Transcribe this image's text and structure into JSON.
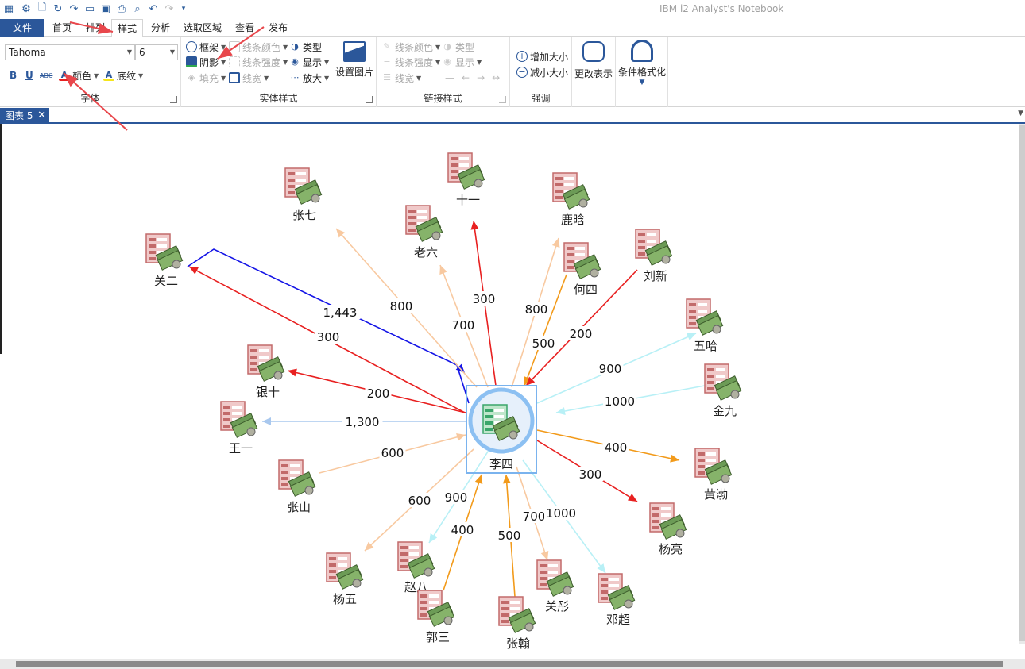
{
  "app_title": "IBM i2 Analyst's Notebook",
  "tabs": [
    "文件",
    "首页",
    "排列",
    "样式",
    "分析",
    "选取区域",
    "查看",
    "发布"
  ],
  "ribbon": {
    "font_group": {
      "label": "字体",
      "font_name": "Tahoma",
      "font_size": "6",
      "bold": "B",
      "underline": "U",
      "strike": "ABC",
      "color": "颜色",
      "shading": "底纹"
    },
    "entity_style": {
      "label": "实体样式",
      "frame": "框架",
      "shadow": "阴影",
      "fill": "填充",
      "line_color": "线条颜色",
      "line_strength": "线条强度",
      "line_width": "线宽",
      "type": "类型",
      "show": "显示",
      "enlarge": "放大",
      "set_picture": "设置图片"
    },
    "link_style": {
      "label": "链接样式",
      "line_color": "线条颜色",
      "line_strength": "线条强度",
      "line_width": "线宽",
      "type": "类型",
      "show": "显示"
    },
    "emphasis": {
      "label": "强调",
      "increase": "增加大小",
      "decrease": "减小大小"
    },
    "change_repr": "更改表示",
    "conditional_format": "条件格式化"
  },
  "document_tab": "图表 5",
  "colors": {
    "file_tab": "#2b579a",
    "link_red": "#e82020",
    "link_orange": "#f29a1a",
    "link_peach": "#f8c9a0",
    "link_cyan": "#b8f0f6",
    "link_lightblue": "#a9c8ee",
    "link_blue": "#1414e6",
    "annotation_arrow": "#e8474c"
  },
  "graph": {
    "center": "李四",
    "nodes": [
      {
        "id": "zhangqi",
        "label": "张七"
      },
      {
        "id": "shiyi",
        "label": "十一"
      },
      {
        "id": "luhan",
        "label": "鹿晗"
      },
      {
        "id": "laoliu",
        "label": "老六"
      },
      {
        "id": "guaner",
        "label": "关二"
      },
      {
        "id": "hesi",
        "label": "何四"
      },
      {
        "id": "liuxin",
        "label": "刘新"
      },
      {
        "id": "wuha",
        "label": "五哈"
      },
      {
        "id": "yinshi",
        "label": "银十"
      },
      {
        "id": "jinjiu",
        "label": "金九"
      },
      {
        "id": "wangyi",
        "label": "王一"
      },
      {
        "id": "huangbo",
        "label": "黄渤"
      },
      {
        "id": "zhangshan",
        "label": "张山"
      },
      {
        "id": "yangliang",
        "label": "杨亮"
      },
      {
        "id": "yangwu",
        "label": "杨五"
      },
      {
        "id": "zhaoba",
        "label": "赵八"
      },
      {
        "id": "guotong",
        "label": "关彤"
      },
      {
        "id": "dengchao",
        "label": "邓超"
      },
      {
        "id": "guosan",
        "label": "郭三"
      },
      {
        "id": "zhanghan",
        "label": "张翰"
      }
    ],
    "links": [
      {
        "node": "guaner",
        "label": "1,443",
        "color": "blue",
        "dir": "in"
      },
      {
        "node": "guaner",
        "label": "300",
        "color": "red",
        "dir": "out"
      },
      {
        "node": "zhangqi",
        "label": "800",
        "color": "peach",
        "dir": "out"
      },
      {
        "node": "laoliu",
        "label": "700",
        "color": "peach",
        "dir": "out"
      },
      {
        "node": "shiyi",
        "label": "300",
        "color": "red",
        "dir": "out"
      },
      {
        "node": "luhan",
        "label": "800",
        "color": "peach",
        "dir": "out"
      },
      {
        "node": "hesi",
        "label": "500",
        "color": "orange",
        "dir": "in"
      },
      {
        "node": "liuxin",
        "label": "200",
        "color": "red",
        "dir": "in"
      },
      {
        "node": "wuha",
        "label": "900",
        "color": "cyan",
        "dir": "out"
      },
      {
        "node": "jinjiu",
        "label": "1000",
        "color": "cyan",
        "dir": "in"
      },
      {
        "node": "yinshi",
        "label": "200",
        "color": "red",
        "dir": "out"
      },
      {
        "node": "wangyi",
        "label": "1,300",
        "color": "lightblue",
        "dir": "out"
      },
      {
        "node": "zhangshan",
        "label": "600",
        "color": "peach",
        "dir": "in"
      },
      {
        "node": "huangbo",
        "label": "400",
        "color": "orange",
        "dir": "out"
      },
      {
        "node": "yangliang",
        "label": "300",
        "color": "red",
        "dir": "out"
      },
      {
        "node": "yangwu",
        "label": "600",
        "color": "peach",
        "dir": "out"
      },
      {
        "node": "zhaoba",
        "label": "900",
        "color": "cyan",
        "dir": "out"
      },
      {
        "node": "guosan",
        "label": "400",
        "color": "orange",
        "dir": "in"
      },
      {
        "node": "zhanghan",
        "label": "500",
        "color": "orange",
        "dir": "in"
      },
      {
        "node": "guotong",
        "label": "700",
        "color": "peach",
        "dir": "out"
      },
      {
        "node": "dengchao",
        "label": "1000",
        "color": "cyan",
        "dir": "out"
      }
    ]
  }
}
